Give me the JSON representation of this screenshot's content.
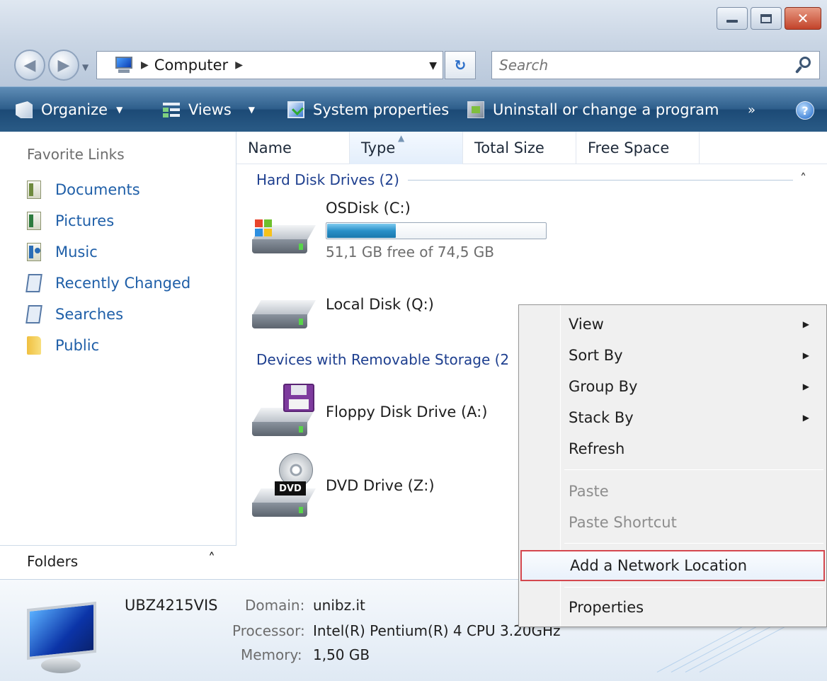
{
  "window": {
    "minimize_icon": "minimize-icon",
    "maximize_icon": "maximize-icon",
    "close_icon": "close-icon",
    "close_glyph": "✕"
  },
  "address": {
    "path_text": "Computer",
    "refresh_glyph": "↻",
    "search_placeholder": "Search"
  },
  "commandbar": {
    "organize": "Organize",
    "views": "Views",
    "system_properties": "System properties",
    "uninstall": "Uninstall or change a program",
    "more": "»",
    "help": "?"
  },
  "navpane": {
    "header": "Favorite Links",
    "links": [
      "Documents",
      "Pictures",
      "Music",
      "Recently Changed",
      "Searches",
      "Public"
    ],
    "folders_label": "Folders"
  },
  "columns": [
    "Name",
    "Type",
    "Total Size",
    "Free Space"
  ],
  "groups": {
    "hard_disks": "Hard Disk Drives (2)",
    "removable": "Devices with Removable Storage (2"
  },
  "drives": {
    "c": {
      "label": "OSDisk (C:)",
      "free_text": "51,1 GB free of 74,5 GB",
      "used_fraction": 0.314
    },
    "q": {
      "label": "Local Disk (Q:)"
    },
    "a": {
      "label": "Floppy Disk Drive (A:)"
    },
    "z": {
      "label": "DVD Drive (Z:)",
      "badge": "DVD"
    }
  },
  "details": {
    "computer_name": "UBZ4215VIS",
    "domain_label": "Domain:",
    "domain_value": "unibz.it",
    "processor_label": "Processor:",
    "processor_value": "Intel(R) Pentium(R) 4 CPU 3.20GHz",
    "memory_label": "Memory:",
    "memory_value": "1,50 GB"
  },
  "context_menu": {
    "view": "View",
    "sort_by": "Sort By",
    "group_by": "Group By",
    "stack_by": "Stack By",
    "refresh": "Refresh",
    "paste": "Paste",
    "paste_shortcut": "Paste Shortcut",
    "add_network_location": "Add a Network Location",
    "properties": "Properties",
    "submenu_glyph": "▶"
  },
  "colors": {
    "accent_blue": "#1f5fa8",
    "group_header": "#1e3f8f",
    "highlight_border": "#d4474e",
    "capacity_fill": "#2a90c8"
  }
}
